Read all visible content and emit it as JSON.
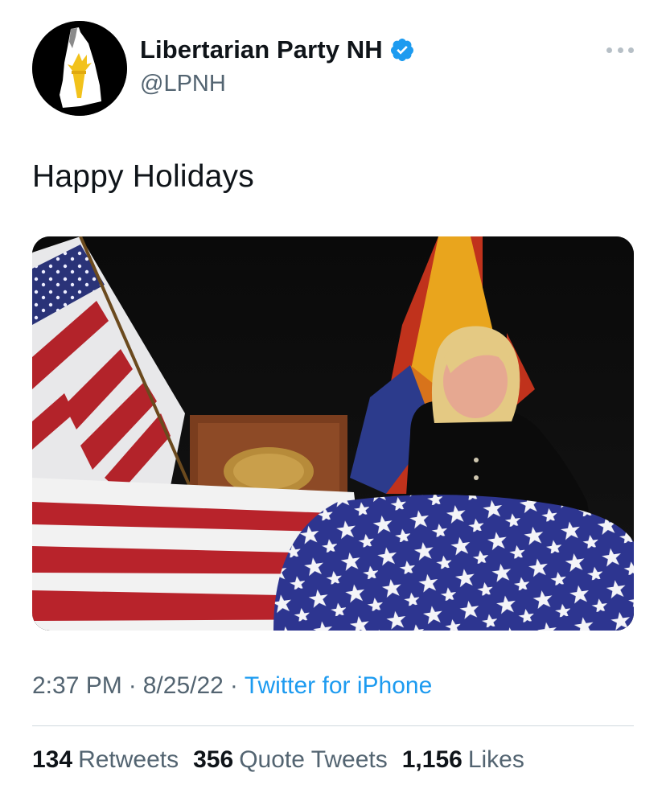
{
  "tweet": {
    "author": {
      "display_name": "Libertarian Party NH",
      "handle": "@LPNH",
      "verified": true,
      "avatar_icon": "nh-state-torch-logo"
    },
    "more_icon": "ellipsis-icon",
    "text": "Happy Holidays",
    "media": {
      "type": "photo"
    },
    "time": "2:37 PM",
    "date": "8/25/22",
    "separator": "·",
    "source": "Twitter for iPhone",
    "stats": {
      "retweets_count": "134",
      "retweets_label": "Retweets",
      "quotes_count": "356",
      "quotes_label": "Quote Tweets",
      "likes_count": "1,156",
      "likes_label": "Likes"
    }
  },
  "colors": {
    "text": "#0f1419",
    "secondary": "#536471",
    "link": "#1d9bf0",
    "verified": "#1d9bf0",
    "divider": "#cfd9de"
  }
}
